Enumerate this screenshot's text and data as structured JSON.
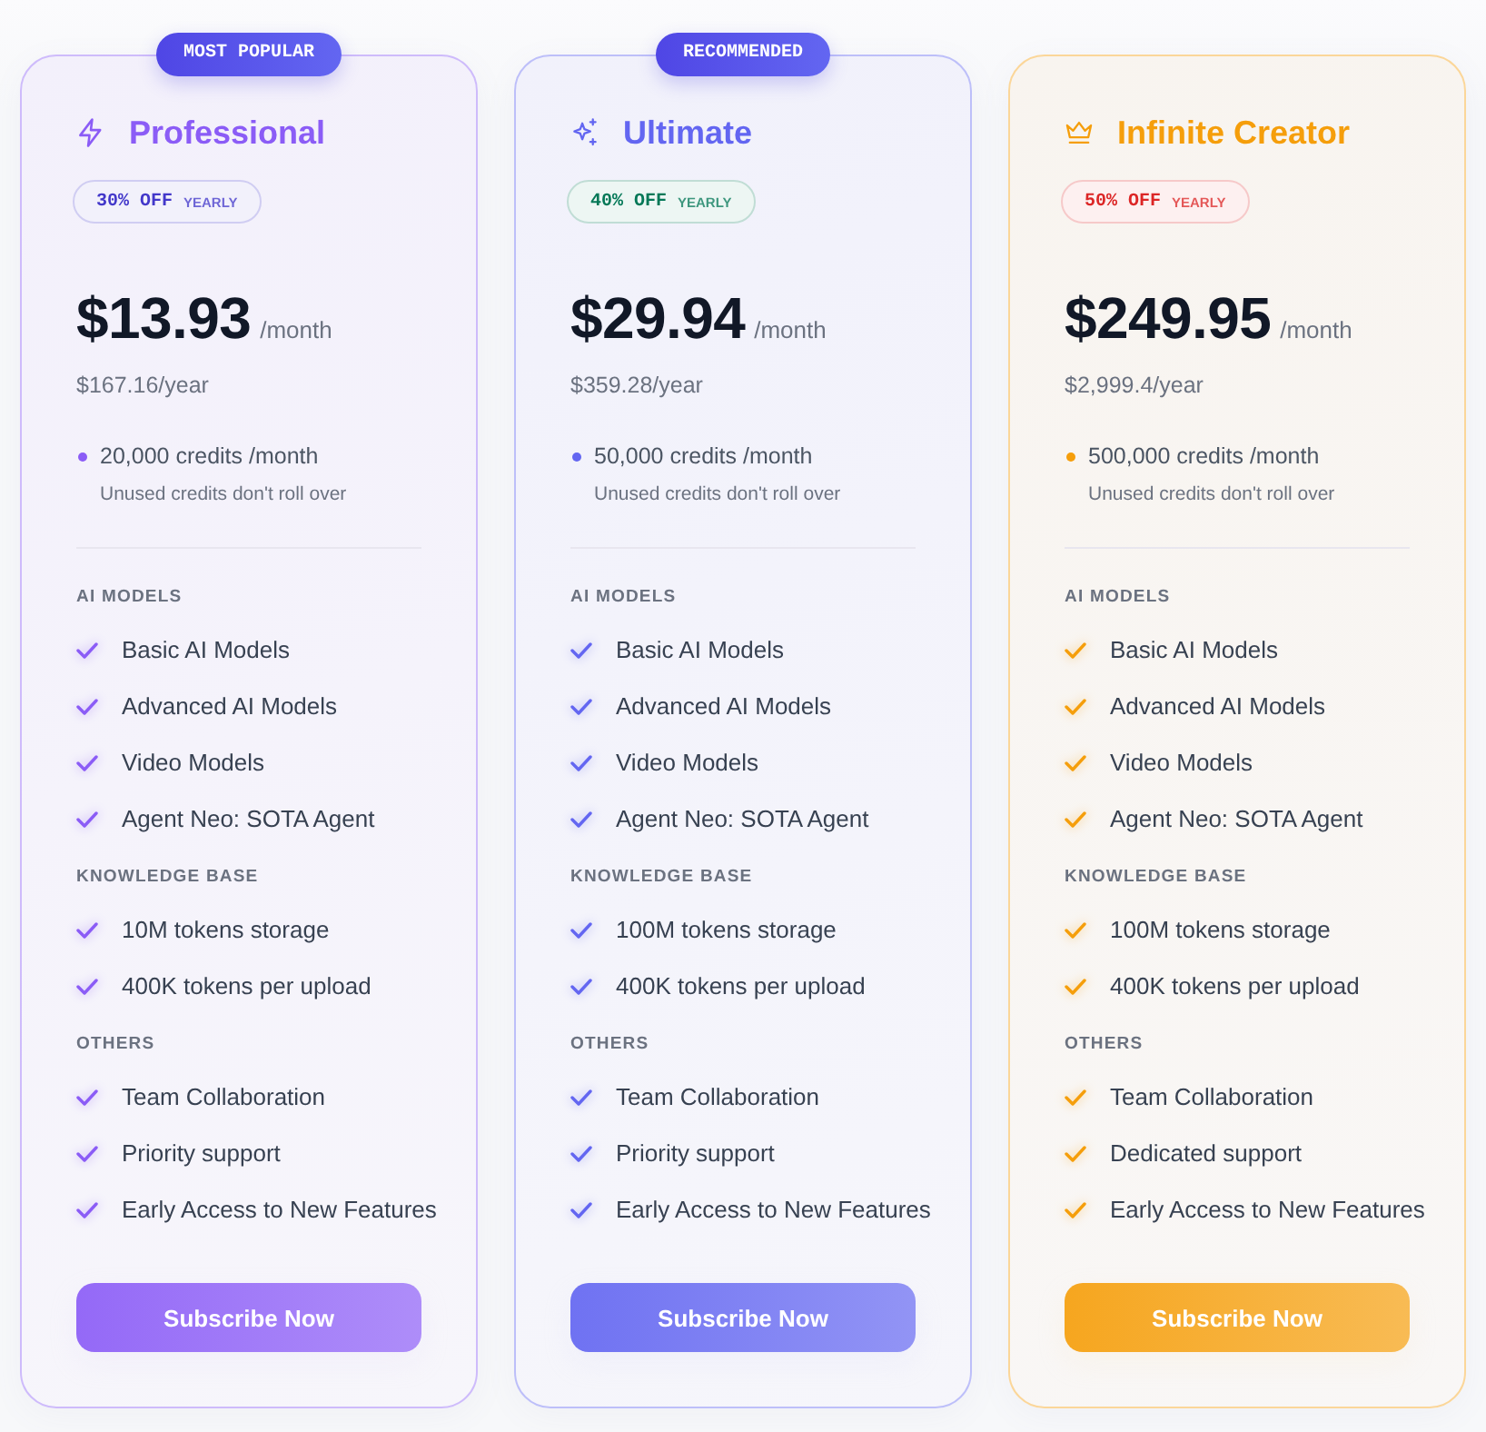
{
  "plans": [
    {
      "name": "Professional",
      "color": "#8b5cf6",
      "ribbon": "MOST POPULAR",
      "discount": {
        "amount": "30% OFF",
        "period": "YEARLY",
        "color": "#4338ca"
      },
      "price": "$13.93",
      "per": "/month",
      "yearly": "$167.16/year",
      "credits": "20,000 credits /month",
      "credits_note": "Unused credits don't roll over",
      "sections": [
        {
          "heading": "AI MODELS",
          "features": [
            "Basic AI Models",
            "Advanced AI Models",
            "Video Models",
            "Agent Neo: SOTA Agent"
          ]
        },
        {
          "heading": "KNOWLEDGE BASE",
          "features": [
            "10M tokens storage",
            "400K tokens per upload"
          ]
        },
        {
          "heading": "OTHERS",
          "features": [
            "Team Collaboration",
            "Priority support",
            "Early Access to New Features"
          ]
        }
      ],
      "button": "Subscribe Now"
    },
    {
      "name": "Ultimate",
      "color": "#6366f1",
      "ribbon": "RECOMMENDED",
      "discount": {
        "amount": "40% OFF",
        "period": "YEARLY",
        "color": "#047857"
      },
      "price": "$29.94",
      "per": "/month",
      "yearly": "$359.28/year",
      "credits": "50,000 credits /month",
      "credits_note": "Unused credits don't roll over",
      "sections": [
        {
          "heading": "AI MODELS",
          "features": [
            "Basic AI Models",
            "Advanced AI Models",
            "Video Models",
            "Agent Neo: SOTA Agent"
          ]
        },
        {
          "heading": "KNOWLEDGE BASE",
          "features": [
            "100M tokens storage",
            "400K tokens per upload"
          ]
        },
        {
          "heading": "OTHERS",
          "features": [
            "Team Collaboration",
            "Priority support",
            "Early Access to New Features"
          ]
        }
      ],
      "button": "Subscribe Now"
    },
    {
      "name": "Infinite Creator",
      "color": "#f59e0b",
      "discount": {
        "amount": "50% OFF",
        "period": "YEARLY",
        "color": "#dc2626"
      },
      "price": "$249.95",
      "per": "/month",
      "yearly": "$2,999.4/year",
      "credits": "500,000 credits /month",
      "credits_note": "Unused credits don't roll over",
      "sections": [
        {
          "heading": "AI MODELS",
          "features": [
            "Basic AI Models",
            "Advanced AI Models",
            "Video Models",
            "Agent Neo: SOTA Agent"
          ]
        },
        {
          "heading": "KNOWLEDGE BASE",
          "features": [
            "100M tokens storage",
            "400K tokens per upload"
          ]
        },
        {
          "heading": "OTHERS",
          "features": [
            "Team Collaboration",
            "Dedicated support",
            "Early Access to New Features"
          ]
        }
      ],
      "button": "Subscribe Now"
    }
  ]
}
